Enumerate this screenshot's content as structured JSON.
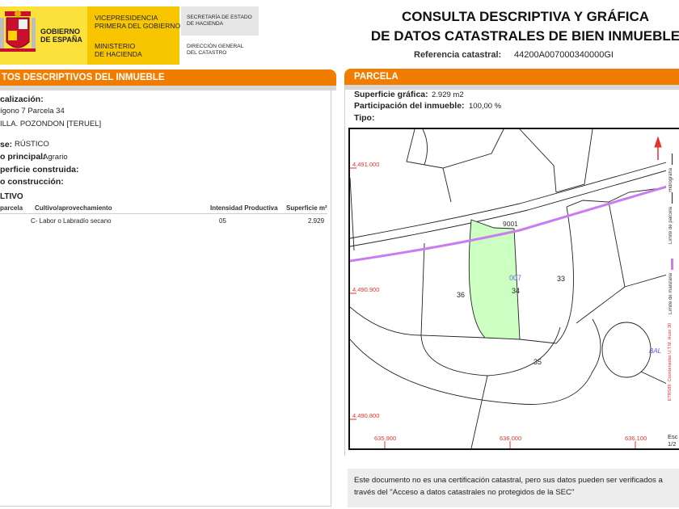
{
  "header": {
    "gov_line1": "GOBIERNO",
    "gov_line2": "DE ESPAÑA",
    "vp_line1": "VICEPRESIDENCIA",
    "vp_line2": "PRIMERA DEL GOBIERNO",
    "min_line1": "MINISTERIO",
    "min_line2": "DE HACIENDA",
    "sec_line1": "SECRETARÍA DE ESTADO",
    "sec_line2": "DE HACIENDA",
    "dg_line1": "DIRECCIÓN GENERAL",
    "dg_line2": "DEL CATASTRO",
    "title_line1": "CONSULTA DESCRIPTIVA Y GRÁFICA",
    "title_line2": "DE DATOS CATASTRALES DE BIEN INMUEBLE",
    "ref_label": "Referencia catastral:",
    "ref_value": "44200A007000340000GI"
  },
  "left": {
    "bar_title": "TOS DESCRIPTIVOS DEL INMUEBLE",
    "loc_label": "calización:",
    "loc_line1": "ígono 7 Parcela 34",
    "loc_line2": "ILLA. POZONDON [TERUEL]",
    "clase_label": "se:",
    "clase_value": "RÚSTICO",
    "uso_label": "o principal:",
    "uso_value": "Agrario",
    "sup_label": "perficie construida:",
    "ano_label": "o construcción:",
    "cultivo_title": "LTIVO",
    "table": {
      "headers": [
        "parcela",
        "Cultivo/aprovechamiento",
        "Intensidad Productiva",
        "Superficie m²"
      ],
      "rows": [
        [
          "",
          "C- Labor o Labradío secano",
          "05",
          "2.929"
        ]
      ]
    }
  },
  "right": {
    "bar_title": "PARCELA",
    "sup_label": "Superficie gráfica:",
    "sup_value": "2.929 m2",
    "part_label": "Participación del inmueble:",
    "part_value": "100,00 %",
    "tipo_label": "Tipo:",
    "map": {
      "y_ticks": [
        "4.491.000",
        "4.490.900",
        "4.490.800"
      ],
      "x_ticks": [
        "635.900",
        "636.000",
        "636.100"
      ],
      "labels": {
        "road": "9001",
        "parcel_main_top": "007",
        "parcel_main": "34",
        "left": "36",
        "right": "33",
        "bottom": "35",
        "bal": "BAL"
      }
    },
    "legend": {
      "hidro": "Hidrografía",
      "limite_parcela": "Límite de parcela",
      "limite_manzana": "Límite de manzana",
      "coords": "ETRS89: Coordenadas U.T.M. Huso 30",
      "escala_label": "Esc",
      "escala_value": "1/2"
    },
    "colors": {
      "parcel_fill": "#ccffc2",
      "road": "#c97df0",
      "ticks": "#e4332c",
      "orange": "#f07d00"
    }
  },
  "note": {
    "line1": "Este documento no es una certificación catastral, pero sus datos pueden ser verificados a",
    "line2": "través del \"Acceso a datos catastrales no protegidos de la SEC\""
  }
}
